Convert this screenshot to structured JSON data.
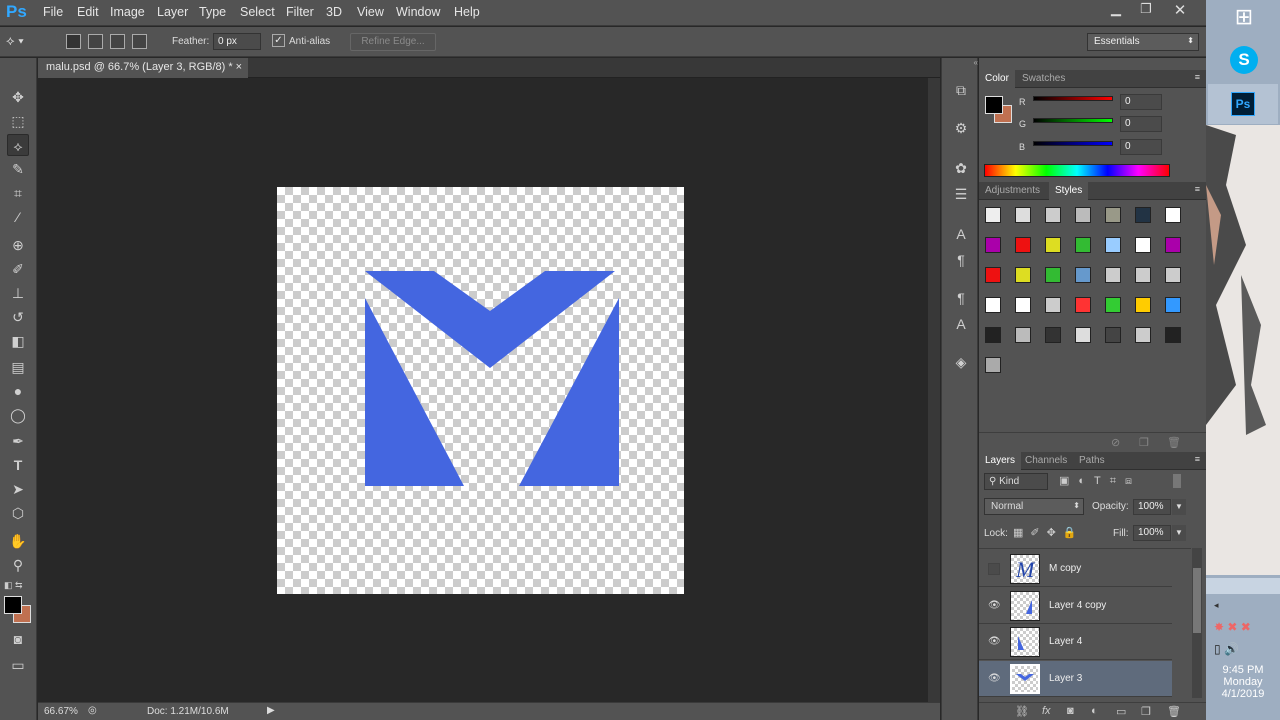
{
  "app": {
    "logo": "Ps"
  },
  "menu": [
    "File",
    "Edit",
    "Image",
    "Layer",
    "Type",
    "Select",
    "Filter",
    "3D",
    "View",
    "Window",
    "Help"
  ],
  "options": {
    "feather_label": "Feather:",
    "feather_value": "0 px",
    "antialias_label": "Anti-alias",
    "refine_edge": "Refine Edge...",
    "workspace": "Essentials"
  },
  "document": {
    "tab_title": "malu.psd @ 66.7% (Layer 3, RGB/8) *",
    "close": "×",
    "zoom": "66.67%",
    "doc_info": "Doc: 1.21M/10.6M",
    "logo_color": "#4466e0"
  },
  "color_panel": {
    "tabs": [
      "Color",
      "Swatches"
    ],
    "foreground": "#000000",
    "background": "#c07050",
    "channels": [
      {
        "label": "R",
        "value": "0"
      },
      {
        "label": "G",
        "value": "0"
      },
      {
        "label": "B",
        "value": "0"
      }
    ]
  },
  "styles_panel": {
    "tabs": [
      "Adjustments",
      "Styles"
    ]
  },
  "layers_panel": {
    "tabs": [
      "Layers",
      "Channels",
      "Paths"
    ],
    "filter_kind": "Kind",
    "blend_mode": "Normal",
    "opacity_label": "Opacity:",
    "opacity_value": "100%",
    "lock_label": "Lock:",
    "fill_label": "Fill:",
    "fill_value": "100%",
    "layers": [
      {
        "name": "M copy",
        "visible": false,
        "selected": false
      },
      {
        "name": "Layer 4 copy",
        "visible": true,
        "selected": false
      },
      {
        "name": "Layer 4",
        "visible": true,
        "selected": false
      },
      {
        "name": "Layer 3",
        "visible": true,
        "selected": true
      }
    ]
  },
  "taskbar": {
    "time": "9:45 PM",
    "day": "Monday",
    "date": "4/1/2019",
    "ps_label": "Ps"
  }
}
